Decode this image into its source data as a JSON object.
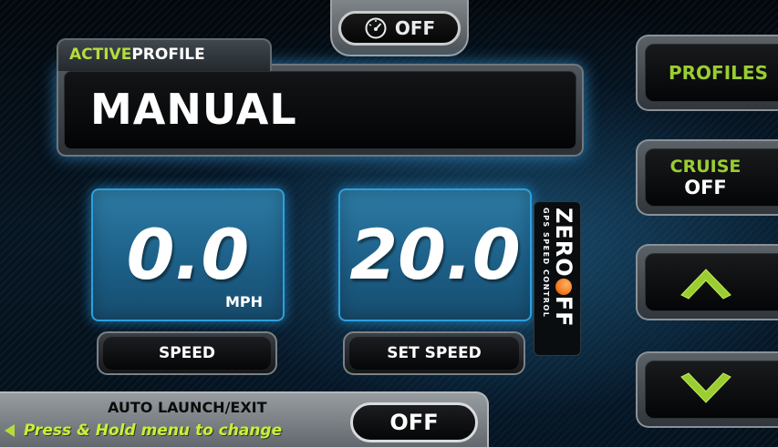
{
  "top": {
    "gauge_icon": "speedometer-icon",
    "status": "OFF"
  },
  "profile": {
    "tab_active": "ACTIVE",
    "tab_profile": "PROFILE",
    "name": "MANUAL"
  },
  "speed": {
    "value": "0.0",
    "unit": "MPH",
    "label": "SPEED"
  },
  "set_speed": {
    "value": "20.0",
    "label": "SET SPEED"
  },
  "logo": {
    "brand_left": "ZERO",
    "brand_right": "FF",
    "tagline": "GPS SPEED CONTROL"
  },
  "sidebar": {
    "profiles_label": "PROFILES",
    "cruise_label": "CRUISE",
    "cruise_status": "OFF",
    "up_icon": "chevron-up-icon",
    "down_icon": "chevron-down-icon"
  },
  "auto_launch": {
    "title": "AUTO LAUNCH/EXIT",
    "hint": "Press & Hold menu to change",
    "status": "OFF"
  },
  "colors": {
    "accent_green": "#9acd32",
    "glow_blue": "#2e9fdc",
    "logo_orange": "#f47a20"
  }
}
